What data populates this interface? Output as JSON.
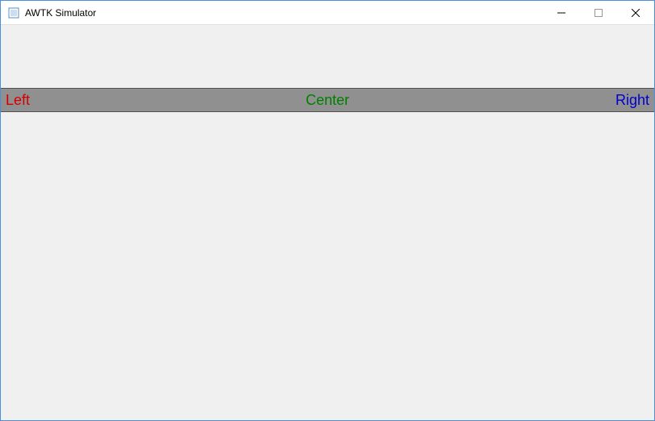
{
  "window": {
    "title": "AWTK Simulator"
  },
  "toolbar": {
    "left_label": "Left",
    "center_label": "Center",
    "right_label": "Right"
  }
}
